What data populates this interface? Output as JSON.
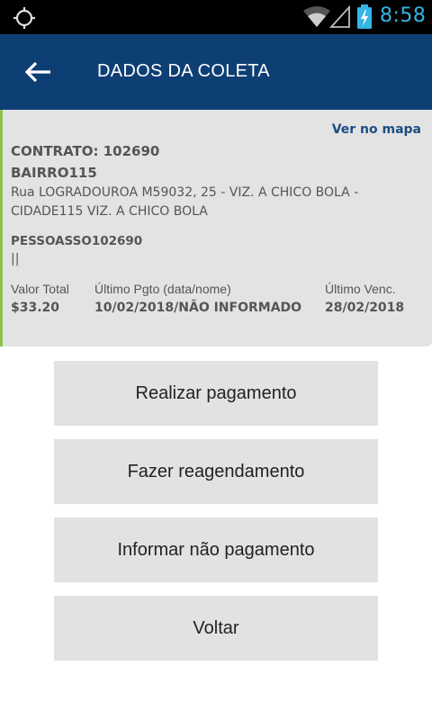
{
  "status_bar": {
    "time": "8:58",
    "icons": [
      "gps-icon",
      "wifi-icon",
      "signal-icon",
      "battery-charging-icon"
    ],
    "icon_color": "#33b5e5"
  },
  "app_bar": {
    "title": "DADOS DA COLETA",
    "back_icon": "arrow-left-icon",
    "background": "#0e3f74"
  },
  "card": {
    "map_link": "Ver no mapa",
    "contract": "CONTRATO: 102690",
    "neighborhood": "BAIRRO115",
    "address": "Rua LOGRADOUROA M59032, 25 - VIZ. A CHICO BOLA - CIDADE115 VIZ. A CHICO BOLA",
    "person": "PESSOASSO102690",
    "extra": "||",
    "columns": [
      {
        "label": "Valor Total",
        "value": "$33.20"
      },
      {
        "label": "Último Pgto (data/nome)",
        "value": "10/02/2018/NÃO INFORMADO"
      },
      {
        "label": "Último Venc.",
        "value": "28/02/2018"
      }
    ],
    "accent_color": "#8bc34a"
  },
  "actions": {
    "pay": "Realizar pagamento",
    "reschedule": "Fazer reagendamento",
    "no_payment": "Informar não pagamento",
    "back": "Voltar"
  }
}
